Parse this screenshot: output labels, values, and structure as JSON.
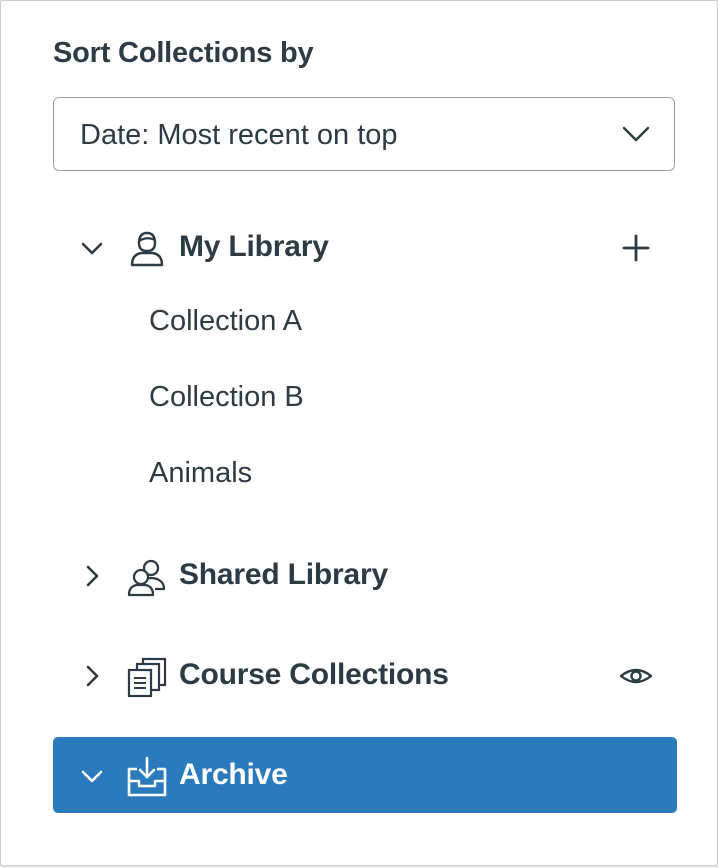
{
  "sort": {
    "label": "Sort Collections by",
    "selected": "Date: Most recent on top"
  },
  "tree": {
    "my_library": {
      "label": "My Library",
      "expanded": true,
      "icon": "user-icon",
      "action_icon": "plus-icon",
      "children": [
        "Collection A",
        "Collection B",
        "Animals"
      ]
    },
    "shared_library": {
      "label": "Shared Library",
      "expanded": false,
      "icon": "group-icon"
    },
    "course_collections": {
      "label": "Course Collections",
      "expanded": false,
      "icon": "collections-icon",
      "action_icon": "eye-icon"
    },
    "archive": {
      "label": "Archive",
      "expanded": true,
      "selected": true,
      "icon": "archive-download-icon"
    }
  },
  "colors": {
    "text": "#2d3b45",
    "accent": "#2b7abc",
    "border": "#9aa3a8",
    "on_accent": "#ffffff"
  }
}
